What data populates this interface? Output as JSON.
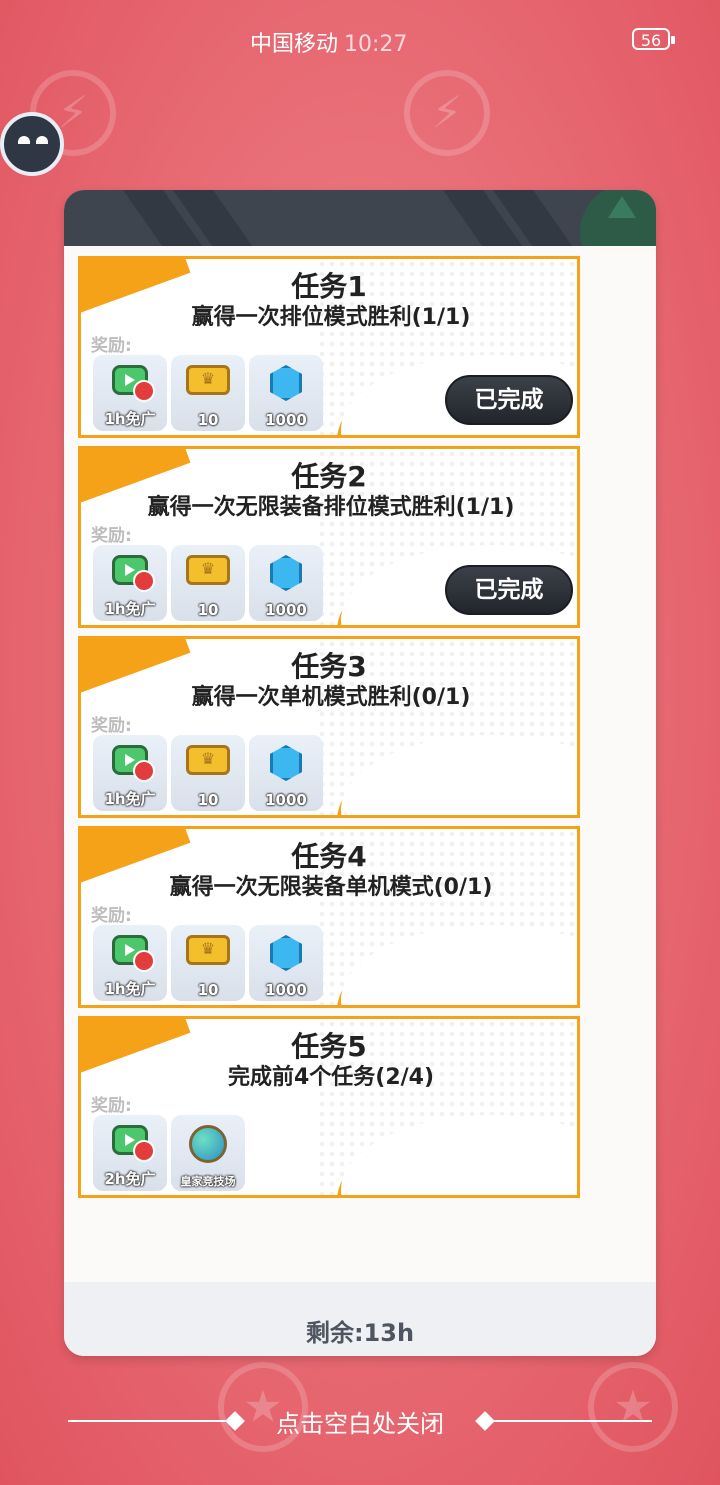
{
  "statusbar": {
    "carrier": "中国移动",
    "time": "10:27",
    "battery": "56"
  },
  "panel": {
    "remaining": "剩余:13h"
  },
  "tasks": [
    {
      "title": "任务1",
      "desc": "赢得一次排位模式胜利(1/1)",
      "reward_label": "奖励:",
      "status": "已完成",
      "rewards": [
        {
          "icon": "ad-free-tv-icon",
          "qty": "1h免广"
        },
        {
          "icon": "gold-ticket-icon",
          "qty": "10"
        },
        {
          "icon": "blue-gem-icon",
          "qty": "1000"
        }
      ]
    },
    {
      "title": "任务2",
      "desc": "赢得一次无限装备排位模式胜利(1/1)",
      "reward_label": "奖励:",
      "status": "已完成",
      "rewards": [
        {
          "icon": "ad-free-tv-icon",
          "qty": "1h免广"
        },
        {
          "icon": "gold-ticket-icon",
          "qty": "10"
        },
        {
          "icon": "blue-gem-icon",
          "qty": "1000"
        }
      ]
    },
    {
      "title": "任务3",
      "desc": "赢得一次单机模式胜利(0/1)",
      "reward_label": "奖励:",
      "rewards": [
        {
          "icon": "ad-free-tv-icon",
          "qty": "1h免广"
        },
        {
          "icon": "gold-ticket-icon",
          "qty": "10"
        },
        {
          "icon": "blue-gem-icon",
          "qty": "1000"
        }
      ]
    },
    {
      "title": "任务4",
      "desc": "赢得一次无限装备单机模式(0/1)",
      "reward_label": "奖励:",
      "rewards": [
        {
          "icon": "ad-free-tv-icon",
          "qty": "1h免广"
        },
        {
          "icon": "gold-ticket-icon",
          "qty": "10"
        },
        {
          "icon": "blue-gem-icon",
          "qty": "1000"
        }
      ]
    },
    {
      "title": "任务5",
      "desc": "完成前4个任务(2/4)",
      "reward_label": "奖励:",
      "rewards": [
        {
          "icon": "ad-free-tv-icon",
          "qty": "2h免广"
        },
        {
          "icon": "royal-arena-globe-icon",
          "qty": "皇家竞技场"
        }
      ]
    }
  ],
  "close_hint": "点击空白处关闭",
  "colors": {
    "accent": "#f5a218",
    "background": "#e96f78",
    "panel_header": "#3e454f"
  }
}
